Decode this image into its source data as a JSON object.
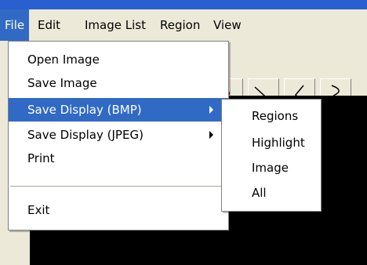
{
  "menubar": {
    "items": [
      {
        "label": "File"
      },
      {
        "label": "Edit"
      },
      {
        "label": "Image List"
      },
      {
        "label": "Region"
      },
      {
        "label": "View"
      }
    ]
  },
  "file_menu": {
    "items": [
      {
        "label": "Open  Image"
      },
      {
        "label": "Save Image"
      },
      {
        "label": "Save Display (BMP)"
      },
      {
        "label": "Save Display (JPEG)"
      },
      {
        "label": "Print"
      },
      {
        "label": "Exit"
      }
    ]
  },
  "submenu": {
    "items": [
      {
        "label": "Regions"
      },
      {
        "label": "Highlight"
      },
      {
        "label": "Image"
      },
      {
        "label": "All"
      }
    ]
  },
  "colors": {
    "highlight": "#316ac5",
    "canvas": "#000000",
    "menu_bg": "#ffffff",
    "menubar_bg": "#ece9d8"
  }
}
